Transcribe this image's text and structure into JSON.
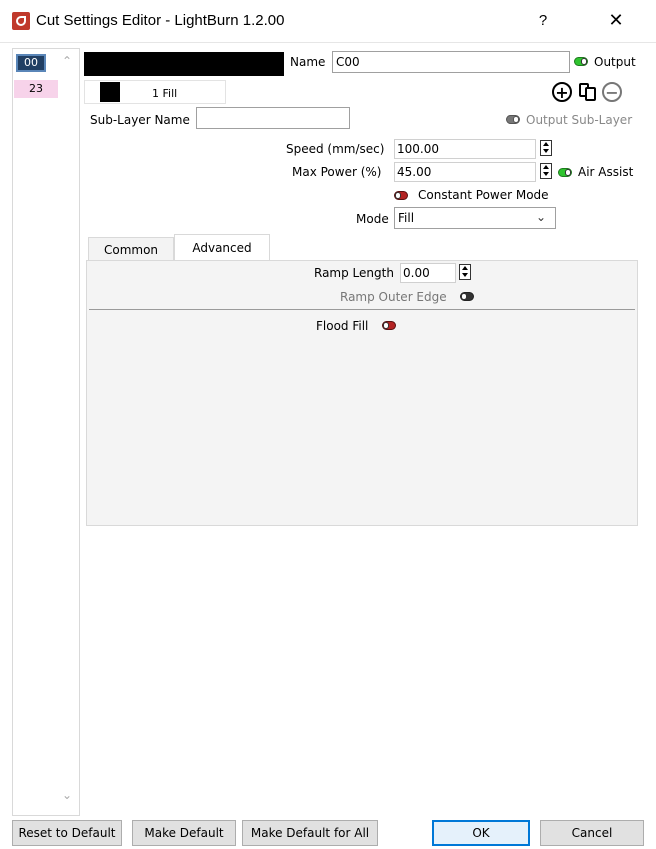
{
  "window": {
    "title": "Cut Settings Editor - LightBurn 1.2.00",
    "help_label": "?",
    "close_label": "✕"
  },
  "layers": [
    {
      "label": "00",
      "color": "#213f63",
      "selected": true
    },
    {
      "label": "23",
      "color": "#f7d3ea",
      "selected": false
    }
  ],
  "layer_scroll": {
    "up": "^",
    "down": "v"
  },
  "layer_color": "#000000",
  "name": {
    "label": "Name",
    "value": "C00"
  },
  "output": {
    "label": "Output",
    "enabled": true
  },
  "sublayer": {
    "tab_label": "1 Fill",
    "color": "#000000",
    "name_label": "Sub-Layer Name",
    "name_value": "",
    "output_label": "Output Sub-Layer",
    "output_enabled": true
  },
  "sublayer_buttons": {
    "add": "add-icon",
    "copy": "copy-icon",
    "remove": "remove-icon"
  },
  "speed": {
    "label": "Speed (mm/sec)",
    "value": "100.00"
  },
  "max_power": {
    "label": "Max Power (%)",
    "value": "45.00"
  },
  "air_assist": {
    "label": "Air Assist",
    "enabled": true
  },
  "constant_power": {
    "label": "Constant Power Mode",
    "enabled": false
  },
  "mode": {
    "label": "Mode",
    "value": "Fill"
  },
  "tabs": [
    {
      "label": "Common",
      "active": false
    },
    {
      "label": "Advanced",
      "active": true
    }
  ],
  "advanced": {
    "ramp_length": {
      "label": "Ramp Length",
      "value": "0.00"
    },
    "ramp_outer_edge": {
      "label": "Ramp Outer Edge",
      "enabled": false
    },
    "flood_fill": {
      "label": "Flood Fill",
      "enabled": false
    }
  },
  "footer": {
    "reset_default": "Reset to Default",
    "make_default": "Make Default",
    "make_default_all": "Make Default for All",
    "ok": "OK",
    "cancel": "Cancel"
  },
  "colors": {
    "accent": "#0078d7",
    "toggle_on": "#2fc42f",
    "toggle_off": "#b42323"
  }
}
